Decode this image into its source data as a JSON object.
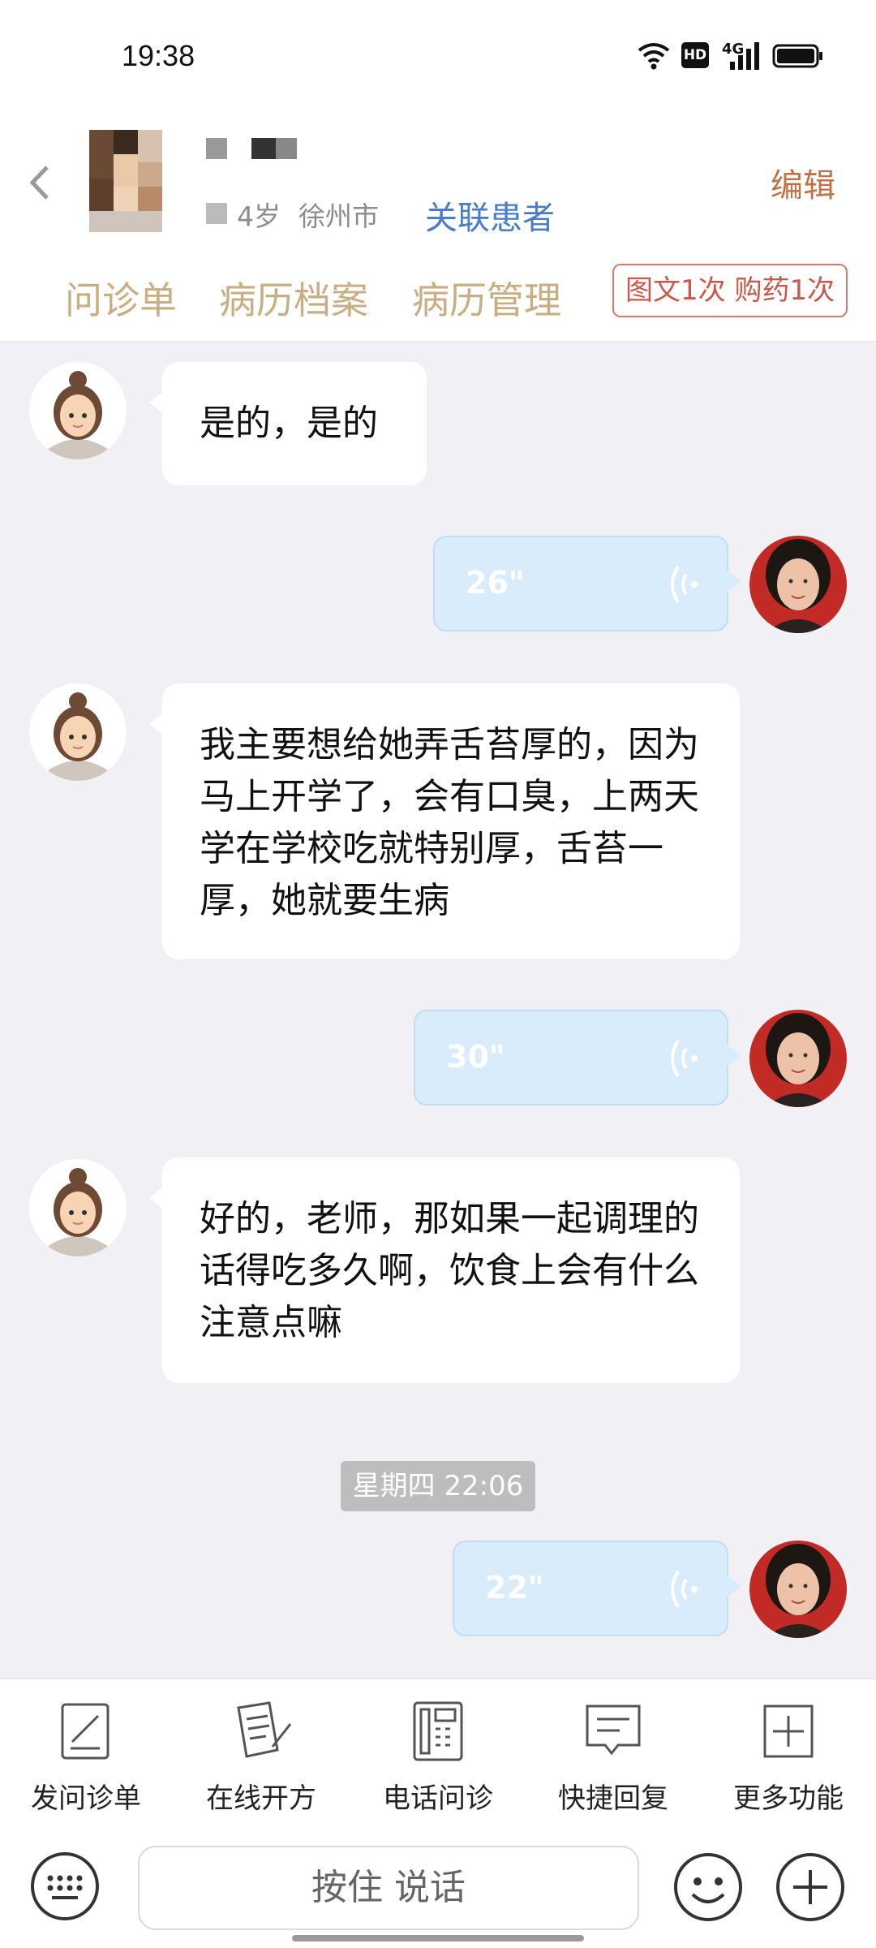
{
  "status_bar": {
    "time": "19:38",
    "hd": "HD",
    "network": "4G"
  },
  "header": {
    "age": "4岁",
    "city": "徐州市",
    "link_patient": "关联患者",
    "edit": "编辑",
    "tabs": [
      "问诊单",
      "病历档案",
      "病历管理"
    ],
    "quota": "图文1次 购药1次"
  },
  "messages": [
    {
      "side": "left",
      "text": "是的，是的"
    },
    {
      "side": "right",
      "type": "voice",
      "duration": "26\""
    },
    {
      "side": "left",
      "text": "我主要想给她弄舌苔厚的，因为马上开学了，会有口臭，上两天学在学校吃就特别厚，舌苔一厚，她就要生病"
    },
    {
      "side": "right",
      "type": "voice",
      "duration": "30\""
    },
    {
      "side": "left",
      "text": "好的，老师，那如果一起调理的话得吃多久啊，饮食上会有什么注意点嘛"
    },
    {
      "side": "right",
      "type": "voice",
      "duration": "22\""
    }
  ],
  "timestamp": "星期四 22:06",
  "toolbar": [
    {
      "label": "发问诊单",
      "icon": "form-icon"
    },
    {
      "label": "在线开方",
      "icon": "prescription-icon"
    },
    {
      "label": "电话问诊",
      "icon": "phone-icon"
    },
    {
      "label": "快捷回复",
      "icon": "quick-reply-icon"
    },
    {
      "label": "更多功能",
      "icon": "more-icon"
    }
  ],
  "input": {
    "hold_to_talk": "按住 说话"
  },
  "colors": {
    "tab": "#c8ae82",
    "link": "#4a7cc8",
    "edit": "#c27146",
    "voice_bubble": "#d9ecfb",
    "chat_bg": "#f1f1f5"
  }
}
